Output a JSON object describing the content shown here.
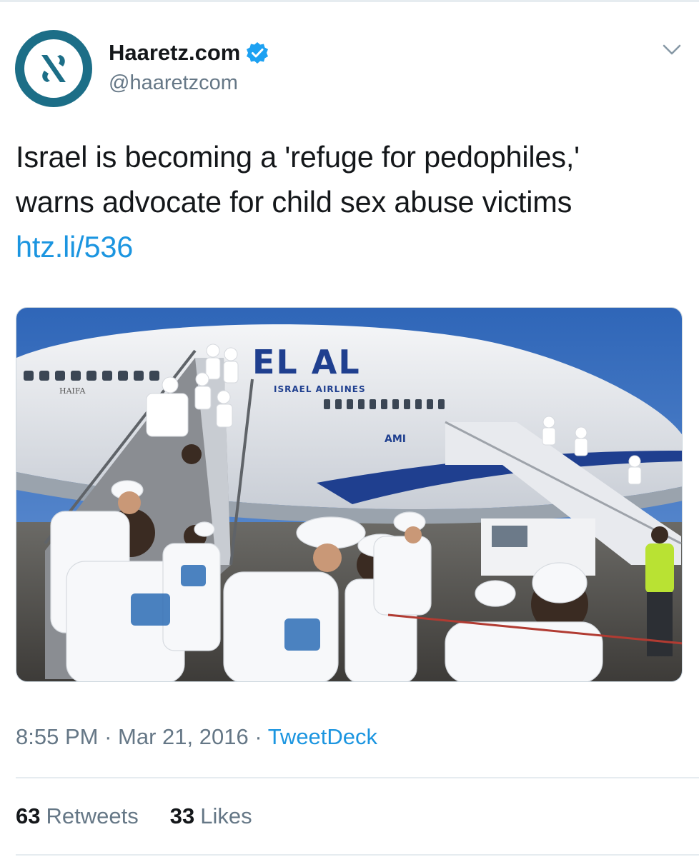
{
  "account": {
    "display_name": "Haaretz.com",
    "handle": "@haaretzcom",
    "verified": true,
    "avatar_icon": "haaretz-aleph-logo",
    "avatar_color": "#1c6e87"
  },
  "tweet": {
    "text_line_1": "Israel is becoming a 'refuge for pedophiles,'",
    "text_line_2": "warns advocate for child sex abuse victims",
    "link": "htz.li/536"
  },
  "media": {
    "airline_logo": "EL AL",
    "airline_name": "ISRAEL AIRLINES",
    "city_name": "HAIFA",
    "sponsor": "AMI"
  },
  "meta": {
    "time": "8:55 PM",
    "date": "Mar 21, 2016",
    "source": "TweetDeck"
  },
  "stats": {
    "retweets_count": "63",
    "retweets_label": "Retweets",
    "likes_count": "33",
    "likes_label": "Likes"
  },
  "colors": {
    "link_blue": "#1b95e0",
    "muted_gray": "#657786",
    "text": "#14171a"
  },
  "icons": {
    "verified": "verified-badge-icon",
    "menu": "chevron-down-icon"
  }
}
